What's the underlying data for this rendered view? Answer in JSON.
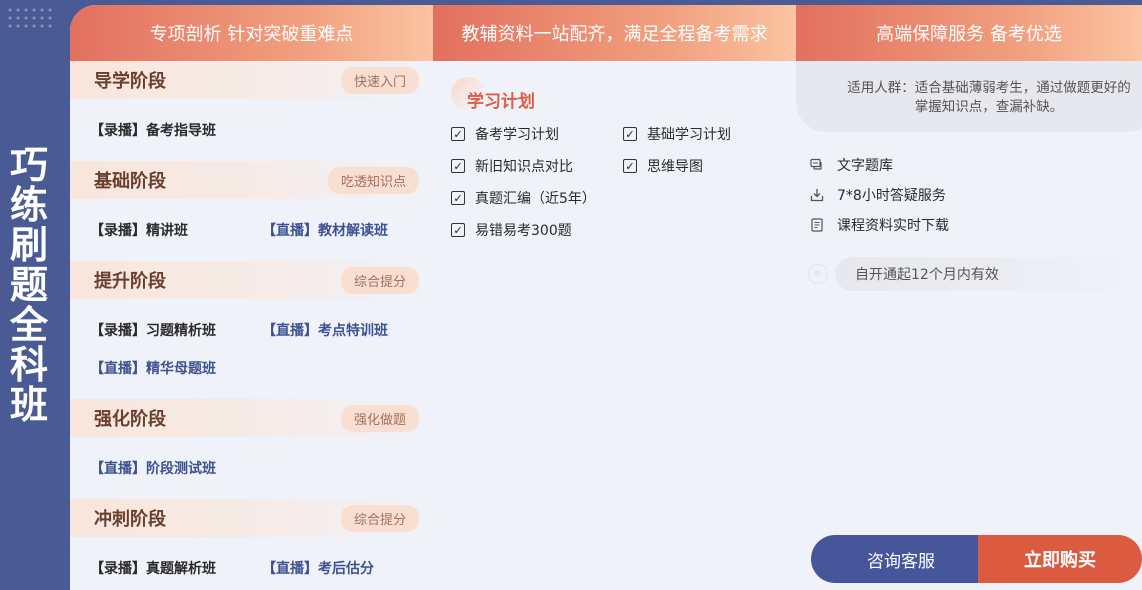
{
  "side": {
    "title": "巧练刷题全科班"
  },
  "headers": [
    "专项剖析 针对突破重难点",
    "教辅资料一站配齐，满足全程备考需求",
    "高端保障服务 备考优选"
  ],
  "stages": [
    {
      "title": "导学阶段",
      "tag": "快速入门",
      "courses": [
        {
          "type": "rec",
          "label": "【录播】备考指导班"
        }
      ]
    },
    {
      "title": "基础阶段",
      "tag": "吃透知识点",
      "courses": [
        {
          "type": "rec",
          "label": "【录播】精讲班"
        },
        {
          "type": "live",
          "label": "【直播】教材解读班"
        }
      ]
    },
    {
      "title": "提升阶段",
      "tag": "综合提分",
      "courses": [
        {
          "type": "rec",
          "label": "【录播】习题精析班"
        },
        {
          "type": "live",
          "label": "【直播】考点特训班"
        },
        {
          "type": "live",
          "label": "【直播】精华母题班"
        }
      ]
    },
    {
      "title": "强化阶段",
      "tag": "强化做题",
      "courses": [
        {
          "type": "live",
          "label": "【直播】阶段测试班"
        }
      ]
    },
    {
      "title": "冲刺阶段",
      "tag": "综合提分",
      "courses": [
        {
          "type": "rec",
          "label": "【录播】真题解析班"
        },
        {
          "type": "live",
          "label": "【直播】考后估分"
        }
      ]
    }
  ],
  "plan": {
    "title": "学习计划",
    "items": [
      "备考学习计划",
      "基础学习计划",
      "新旧知识点对比",
      "思维导图",
      "真题汇编（近5年）",
      "易错易考300题"
    ]
  },
  "service": {
    "audience": "适用人群：适合基础薄弱考生，通过做题更好的掌握知识点，查漏补缺。",
    "items": [
      {
        "icon": "chat-icon",
        "label": "文字题库"
      },
      {
        "icon": "download-icon",
        "label": "7*8小时答疑服务"
      },
      {
        "icon": "document-icon",
        "label": "课程资料实时下载"
      }
    ],
    "validity": "自开通起12个月内有效"
  },
  "buttons": {
    "consult": "咨询客服",
    "buy": "立即购买"
  },
  "colors": {
    "brand_blue": "#46569a",
    "accent_orange": "#dc5a3f",
    "header_grad_start": "#e2705f",
    "header_grad_end": "#fbc4a2"
  }
}
